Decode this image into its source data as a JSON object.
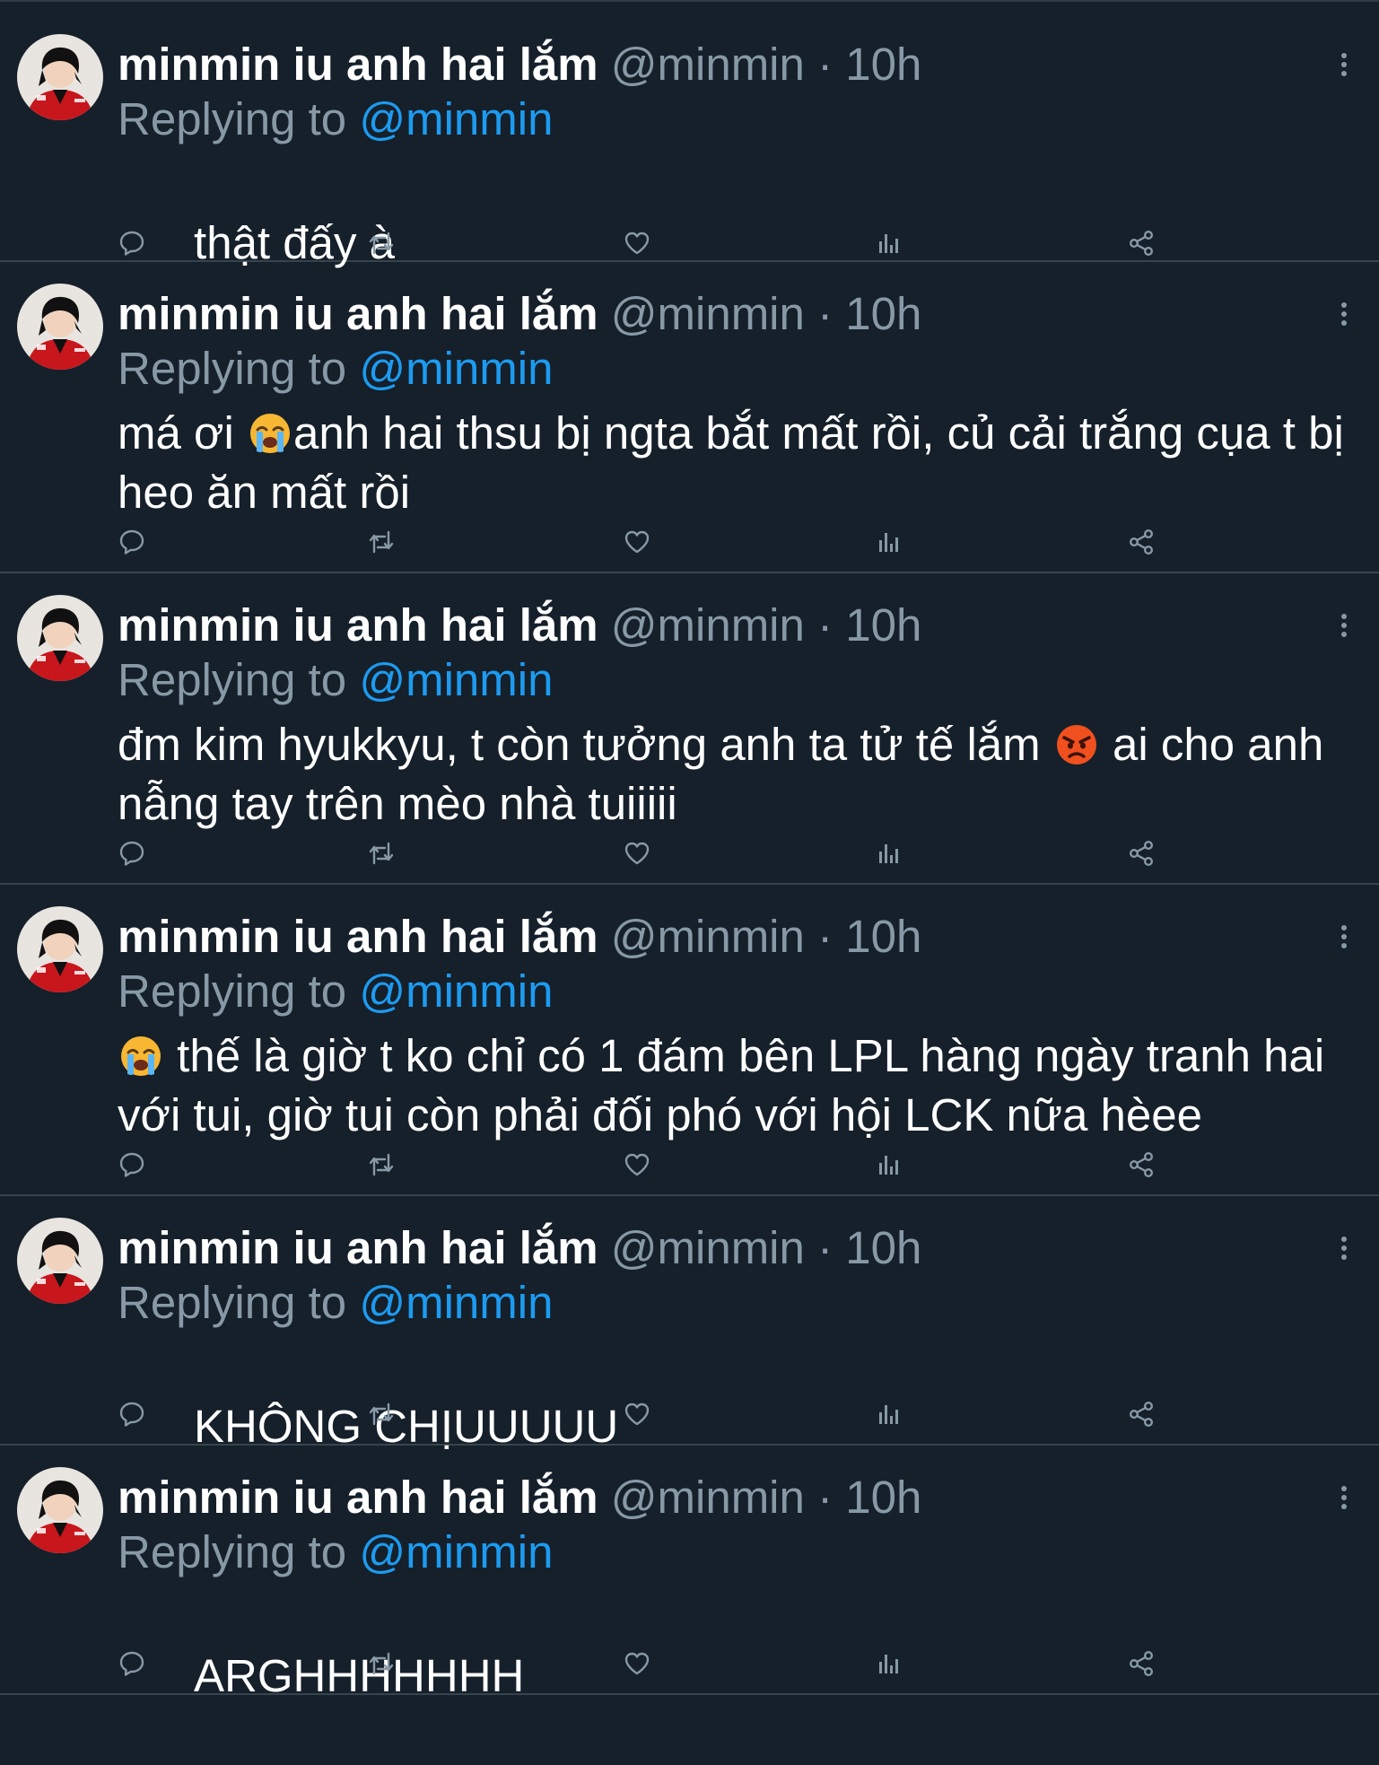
{
  "colors": {
    "background": "#15202b",
    "divider": "#38444d",
    "text_primary": "#ffffff",
    "text_secondary": "#8899a6",
    "link": "#1d9bf0",
    "icon": "#8899a6"
  },
  "author": {
    "name": "minmin iu anh hai lắm",
    "handle": "@minmin",
    "separator": "·",
    "time": "10h"
  },
  "reply_label": "Replying to",
  "reply_mention": "@minmin",
  "icons": {
    "more": "more-vertical-icon",
    "reply": "reply-bubble-icon",
    "retweet": "retweet-icon",
    "like": "heart-icon",
    "views": "bar-chart-icon",
    "share": "share-icon"
  },
  "tweets": [
    {
      "text_segments": [
        {
          "text": "thật đấy à"
        }
      ]
    },
    {
      "text_segments": [
        {
          "text": "má ơi "
        },
        {
          "emoji": "loudly-crying-face-emoji"
        },
        {
          "text": "anh hai thsu bị ngta bắt mất rồi, củ cải trắng cụa t bị heo ăn mất rồi"
        }
      ]
    },
    {
      "text_segments": [
        {
          "text": "đm kim hyukkyu, t còn tưởng anh ta tử tế lắm "
        },
        {
          "emoji": "angry-face-emoji"
        },
        {
          "text": " ai cho anh nẫng tay trên mèo nhà tuiiiii"
        }
      ]
    },
    {
      "text_segments": [
        {
          "emoji": "loudly-crying-face-emoji"
        },
        {
          "text": " thế là giờ t ko chỉ có 1 đám bên LPL hàng ngày tranh hai với tui, giờ tui còn phải đối phó với hội LCK nữa hèee"
        }
      ]
    },
    {
      "text_segments": [
        {
          "text": "KHÔNG CHỊUUUUU"
        }
      ]
    },
    {
      "text_segments": [
        {
          "text": "ARGHHHHHHH"
        }
      ]
    }
  ]
}
